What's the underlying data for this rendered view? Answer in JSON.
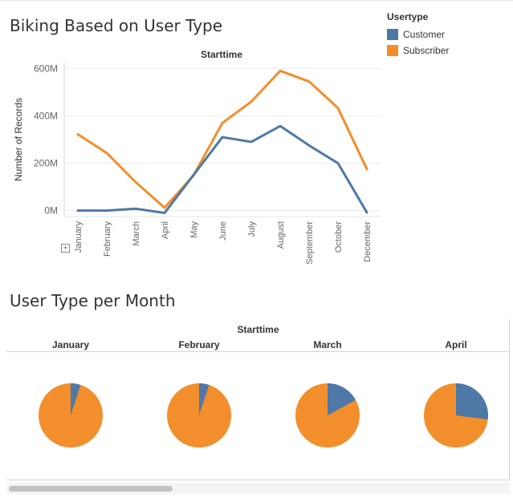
{
  "line_title": "Biking Based on User Type",
  "pie_title": "User Type per Month",
  "legend": {
    "title": "Usertype",
    "items": [
      {
        "label": "Customer",
        "color": "#4e79a7"
      },
      {
        "label": "Subscriber",
        "color": "#f28e2b"
      }
    ]
  },
  "expand_icon": "plus-icon",
  "chart_data": [
    {
      "type": "line",
      "title": "Starttime",
      "xlabel": "Starttime",
      "ylabel": "Number of Records",
      "categories": [
        "January",
        "February",
        "March",
        "April",
        "May",
        "June",
        "July",
        "August",
        "September",
        "October",
        "December"
      ],
      "yticks": [
        {
          "value": 0,
          "label": "0M"
        },
        {
          "value": 200,
          "label": "200M"
        },
        {
          "value": 400,
          "label": "400M"
        },
        {
          "value": 600,
          "label": "600M"
        }
      ],
      "ylim": [
        -25,
        625
      ],
      "grid": true,
      "series": [
        {
          "name": "Customer",
          "color": "#4e79a7",
          "values": [
            0,
            0,
            8,
            -10,
            150,
            310,
            290,
            357,
            275,
            200,
            -8
          ]
        },
        {
          "name": "Subscriber",
          "color": "#f28e2b",
          "values": [
            322,
            243,
            120,
            12,
            148,
            370,
            460,
            590,
            545,
            433,
            175
          ]
        }
      ]
    },
    {
      "type": "pie",
      "title": "Starttime",
      "categories": [
        "January",
        "February",
        "March",
        "April"
      ],
      "series": [
        {
          "name": "Customer",
          "color": "#4e79a7",
          "values": [
            0.05,
            0.05,
            0.17,
            0.27
          ]
        },
        {
          "name": "Subscriber",
          "color": "#f28e2b",
          "values": [
            0.95,
            0.95,
            0.83,
            0.73
          ]
        }
      ]
    }
  ]
}
